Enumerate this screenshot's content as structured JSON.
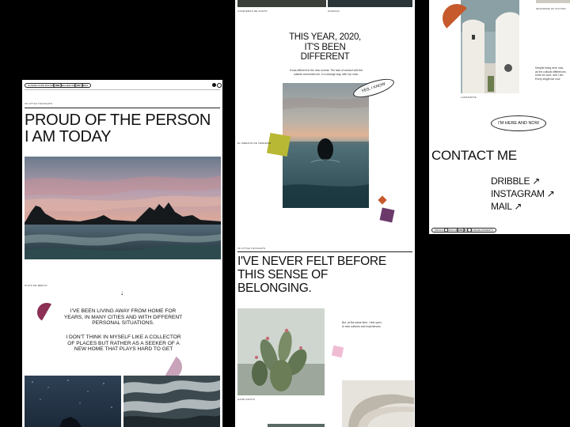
{
  "left": {
    "nav": [
      "Guadeloupe Mountains",
      "Bethelhem Waves",
      "Stories"
    ],
    "section_label": "30 Little Thoughts",
    "title_line1": "PROUD OF THE PERSON",
    "title_line2": "I AM TODAY",
    "photo_caption": "Playa de Benijo",
    "arrow": "↓",
    "para1_line1": "I'VE BEEN LIVING AWAY FROM HOME FOR",
    "para1_line2": "YEARS, IN MANY CITIES AND WITH DIFFERENT",
    "para1_line3": "PERSONAL SITUATIONS.",
    "para2_line1": "I DON'T THINK IN MYSELF LIKE A COLLECTOR",
    "para2_line2": "OF PLACES BUT RATHER AS A SEEKER OF A",
    "para2_line3": "NEW HOME THAT PLAYS HARD TO GET"
  },
  "middle": {
    "top_caption_left": "Cafeteras de Santo",
    "top_caption_right": "Oceanic",
    "heading_line1": "THIS YEAR, 2020,",
    "heading_line2": "IT'S BEEN",
    "heading_line3": "DIFFERENT",
    "body_line1": "It was different in the new normal. The lack of contact with the",
    "body_line2": "outside connected me, in a strange way, with my roots.",
    "badge": "YES, I KNOW",
    "photo_caption": "El Médano de Tenerife",
    "section_label": "30 Little Thoughts",
    "heading2_line1": "I'VE NEVER FELT BEFORE",
    "heading2_line2": "THIS SENSE OF",
    "heading2_line3": "BELONGING.",
    "side_line1": "But, at the same time, I feel open",
    "side_line2": "to new cultures and experiences.",
    "cactus_caption": "Hand Roots"
  },
  "right": {
    "top_caption": "Heatwave of Fiction",
    "photo_caption": "Lanzarote",
    "side_line1": "Despite living here now,",
    "side_line2": "as the cultural differences",
    "side_line3": "show for sure, and I am",
    "side_line4": "Every single bar now",
    "badge": "I'M HERE AND NOW",
    "contact": "CONTACT ME",
    "links": [
      "DRIBBLE ↗",
      "INSTAGRAM ↗",
      "MAIL ↗"
    ],
    "footer": [
      "Privacy",
      "Disclaimer",
      "Terms",
      "31 DEVELOPMENTS"
    ]
  },
  "colors": {
    "accent_purple": "#8c3055",
    "accent_pink": "#c8a3ba",
    "accent_olive": "#b8b835",
    "accent_violet": "#6b3a6b",
    "accent_orange": "#c65a2c",
    "accent_lightpink": "#f0bcd4"
  }
}
